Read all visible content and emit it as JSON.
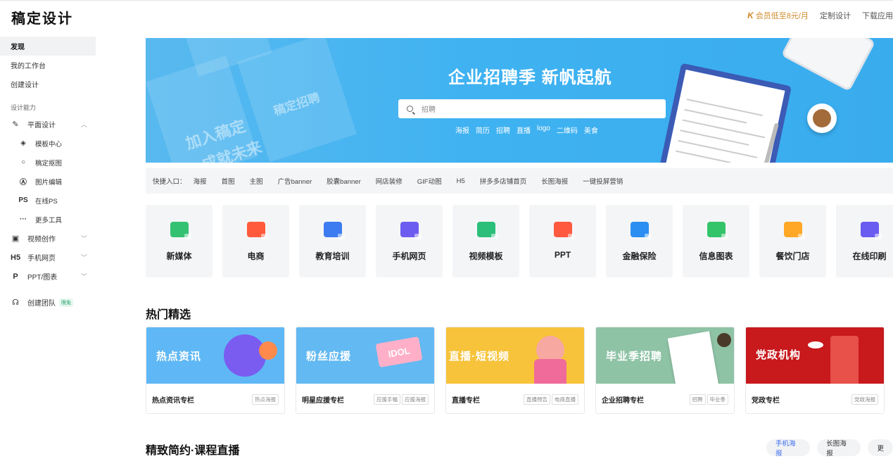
{
  "header": {
    "logo": "稿定设计",
    "vip": "会员低至8元/月",
    "vip_icon": "K",
    "custom": "定制设计",
    "download": "下载应用"
  },
  "sidebar": {
    "discover": "发现",
    "workspace": "我的工作台",
    "create": "创建设计",
    "section": "设计能力",
    "graphic": {
      "label": "平面设计",
      "icon": "pen-icon"
    },
    "graphic_sub": [
      {
        "label": "模板中心",
        "icon": "layers-icon"
      },
      {
        "label": "稿定抠图",
        "icon": "cutout-icon"
      },
      {
        "label": "图片编辑",
        "icon": "edit-image-icon"
      },
      {
        "label": "在线PS",
        "icon": "ps-icon"
      },
      {
        "label": "更多工具",
        "icon": "more-icon"
      }
    ],
    "video": {
      "label": "视频创作",
      "icon": "video-icon"
    },
    "h5": {
      "label": "手机网页",
      "icon": "h5-icon"
    },
    "ppt": {
      "label": "PPT/图表",
      "icon": "ppt-icon"
    },
    "team": {
      "label": "创建团队",
      "badge": "限免",
      "icon": "team-icon"
    }
  },
  "banner": {
    "title": "企业招聘季 新帆起航",
    "search_placeholder": "招聘",
    "poster_texts": [
      "加入稿定",
      "成就未来",
      "稿定招聘"
    ],
    "tags": [
      "海报",
      "简历",
      "招聘",
      "直播",
      "logo",
      "二维码",
      "美食"
    ]
  },
  "quick_entry": {
    "label": "快捷入口：",
    "items": [
      "海报",
      "首图",
      "主图",
      "广告banner",
      "胶囊banner",
      "网店装修",
      "GIF动图",
      "H5",
      "拼多多店铺首页",
      "长图海报",
      "一键投屏营销"
    ]
  },
  "categories": [
    {
      "label": "新媒体",
      "color": "#35c172",
      "icon": "chat-icon"
    },
    {
      "label": "电商",
      "color": "#ff5a3c",
      "icon": "bag-icon"
    },
    {
      "label": "教育培训",
      "color": "#3d7bf0",
      "icon": "book-icon"
    },
    {
      "label": "手机网页",
      "color": "#6c5cf0",
      "icon": "h5-page-icon"
    },
    {
      "label": "视频模板",
      "color": "#2bbf7a",
      "icon": "play-icon"
    },
    {
      "label": "PPT",
      "color": "#ff5940",
      "icon": "ppt-chart-icon"
    },
    {
      "label": "金融保险",
      "color": "#2b8ef0",
      "icon": "money-icon"
    },
    {
      "label": "信息图表",
      "color": "#33c46a",
      "icon": "pie-icon"
    },
    {
      "label": "餐饮门店",
      "color": "#ffa726",
      "icon": "drink-icon"
    },
    {
      "label": "在线印刷",
      "color": "#6a5cf0",
      "icon": "print-icon"
    }
  ],
  "hot": {
    "title": "热门精选",
    "cards": [
      {
        "thumb_text": "热点资讯",
        "title": "热点资讯专栏",
        "tags": [
          "热点海报"
        ],
        "bg": "#5fb8f5"
      },
      {
        "thumb_text": "粉丝应援",
        "title": "明星应援专栏",
        "tags": [
          "应援手幅",
          "应援海报"
        ],
        "bg": "#63b9f2",
        "extra": "IDOL"
      },
      {
        "thumb_text": "直播·短视频",
        "title": "直播专栏",
        "tags": [
          "直播预告",
          "电商直播"
        ],
        "bg": "#f7c33b"
      },
      {
        "thumb_text": "毕业季招聘",
        "title": "企业招聘专栏",
        "tags": [
          "招聘",
          "毕业季"
        ],
        "bg": "#8fc3a6"
      },
      {
        "thumb_text": "党政机构",
        "title": "党政专栏",
        "tags": [
          "党政海报"
        ],
        "bg": "#c8191d"
      }
    ]
  },
  "resume": {
    "title": "精致简约·课程直播",
    "pills": [
      "手机海报",
      "长图海报",
      "更"
    ]
  }
}
